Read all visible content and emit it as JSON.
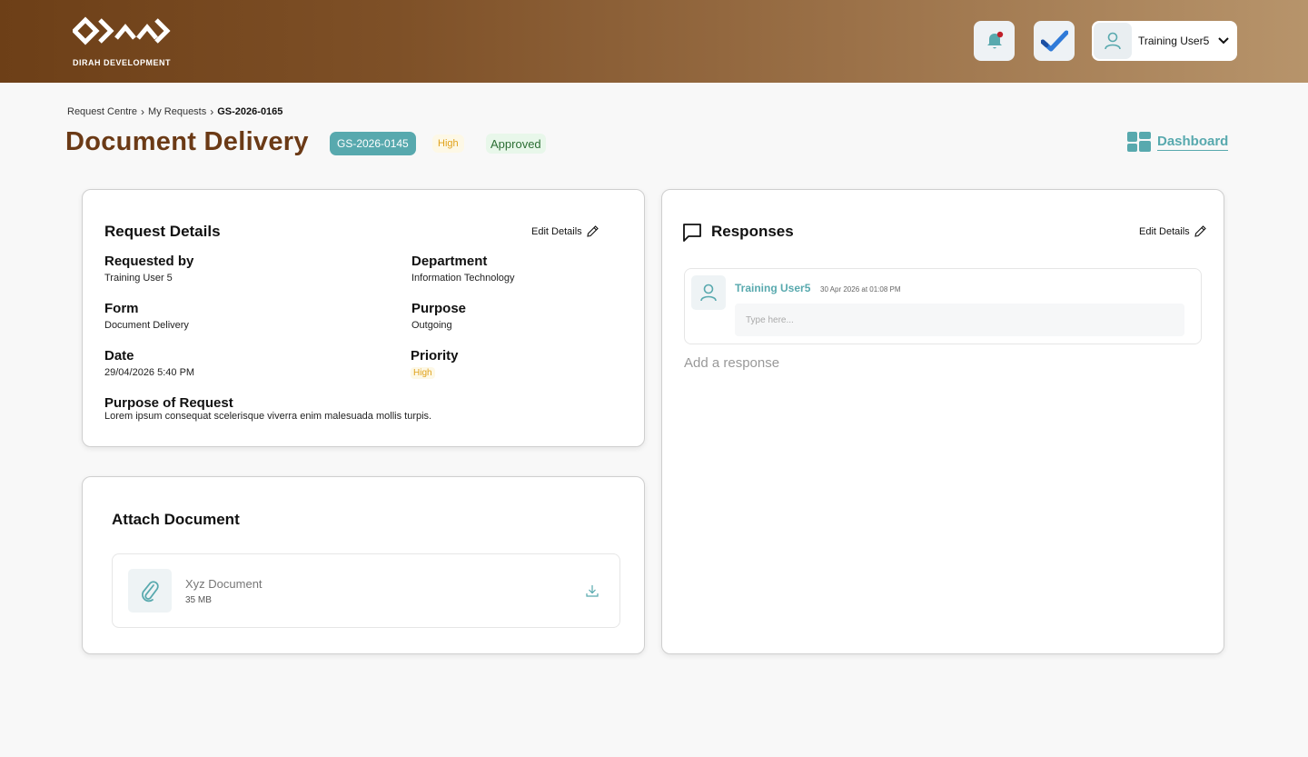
{
  "header": {
    "logo_text": "DIRAH DEVELOPMENT",
    "user_name": "Training User5"
  },
  "breadcrumb": [
    "Request Centre",
    "My Requests",
    "GS-2026-0165"
  ],
  "page": {
    "title": "Document Delivery",
    "code_badge": "GS-2026-0145",
    "priority_badge": "High",
    "status_badge": "Approved",
    "dashboard_label": "Dashboard"
  },
  "details": {
    "title": "Request Details",
    "edit_label": "Edit Details",
    "requested_by_label": "Requested by",
    "requested_by": "Training User 5",
    "department_label": "Department",
    "department": "Information Technology",
    "form_label": "Form",
    "form": "Document Delivery",
    "purpose_label": "Purpose",
    "purpose": "Outgoing",
    "date_label": "Date",
    "date": "29/04/2026 5:40 PM",
    "priority_label": "Priority",
    "priority": "High",
    "purpose_of_request_label": "Purpose of Request",
    "purpose_of_request": "Lorem ipsum consequat scelerisque viverra enim malesuada mollis turpis."
  },
  "attach": {
    "title": "Attach Document",
    "file_name": "Xyz Document",
    "file_size": "35 MB"
  },
  "responses": {
    "title": "Responses",
    "edit_label": "Edit Details",
    "user": "Training User5",
    "timestamp": "30 Apr 2026 at 01:08 PM",
    "input_placeholder": "Type here...",
    "add_response": "Add a response"
  },
  "colors": {
    "brand_brown": "#6b3a16",
    "teal": "#58a9ae",
    "high_text": "#e0a21b",
    "approved_text": "#2c6e34"
  }
}
